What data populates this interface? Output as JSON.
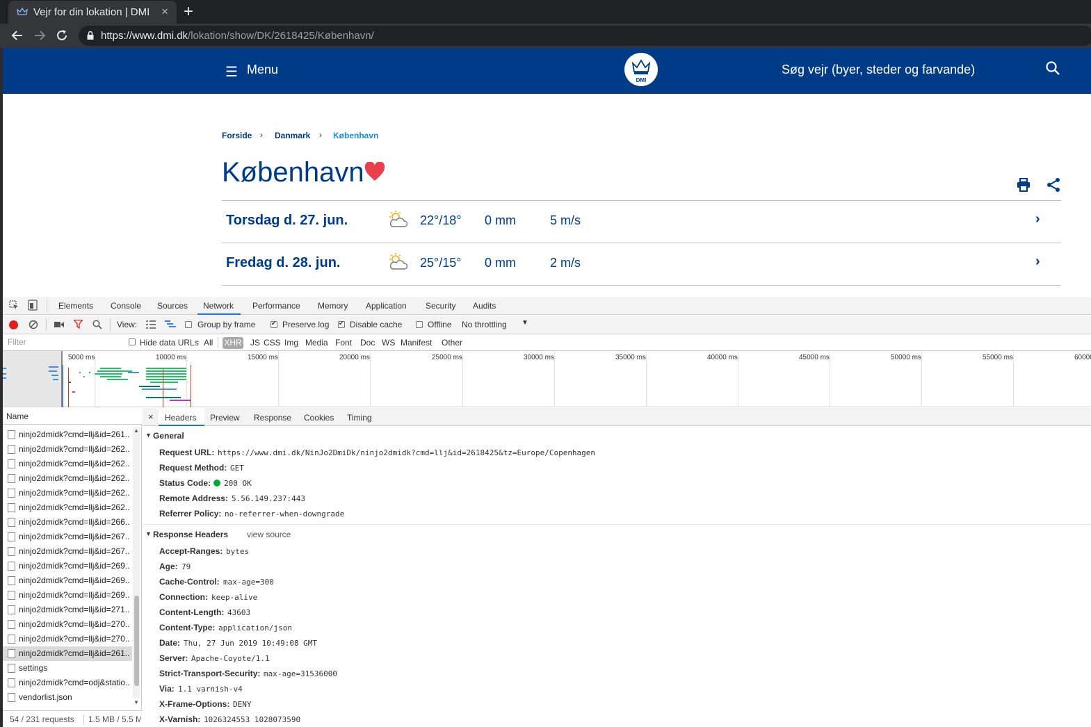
{
  "browser": {
    "tab_title": "Vejr for din lokation | DMI",
    "tab_close": "×",
    "new_tab": "+",
    "url_host": "https://www.dmi.dk",
    "url_path": "/lokation/show/DK/2618425/København/"
  },
  "site": {
    "menu_label": "Menu",
    "logo_text": "DMI",
    "search_placeholder": "Søg vejr (byer, steder og farvande)",
    "breadcrumb": [
      "Forside",
      "Danmark",
      "København"
    ],
    "breadcrumb_sep": "›",
    "city": "København",
    "colors": {
      "header": "#003b87",
      "heart": "#e8414d",
      "breadcrumb_active": "#1a8fd1"
    },
    "forecast": [
      {
        "day": "Torsdag d. 27. jun.",
        "temp": "22°/18°",
        "rain": "0 mm",
        "wind": "5 m/s",
        "icon": "partly-cloudy-icon"
      },
      {
        "day": "Fredag d. 28. jun.",
        "temp": "25°/15°",
        "rain": "0 mm",
        "wind": "2 m/s",
        "icon": "partly-cloudy-icon"
      }
    ]
  },
  "devtools": {
    "tabs": [
      "Elements",
      "Console",
      "Sources",
      "Network",
      "Performance",
      "Memory",
      "Application",
      "Security",
      "Audits"
    ],
    "active_tab": "Network",
    "toolbar": {
      "view_label": "View:",
      "group_by_frame": "Group by frame",
      "preserve_log": "Preserve log",
      "disable_cache": "Disable cache",
      "offline": "Offline",
      "throttling": "No throttling"
    },
    "filter": {
      "placeholder": "Filter",
      "hide_data_urls": "Hide data URLs",
      "types": [
        "All",
        "XHR",
        "JS",
        "CSS",
        "Img",
        "Media",
        "Font",
        "Doc",
        "WS",
        "Manifest",
        "Other"
      ],
      "active_type": "XHR"
    },
    "timeline_ticks": [
      "5000 ms",
      "10000 ms",
      "15000 ms",
      "20000 ms",
      "25000 ms",
      "30000 ms",
      "35000 ms",
      "40000 ms",
      "45000 ms",
      "50000 ms",
      "55000 ms",
      "60000"
    ],
    "requests": {
      "header": "Name",
      "items": [
        "ninjo2dmidk?cmd=llj&id=261...",
        "ninjo2dmidk?cmd=llj&id=262...",
        "ninjo2dmidk?cmd=llj&id=262...",
        "ninjo2dmidk?cmd=llj&id=262...",
        "ninjo2dmidk?cmd=llj&id=262...",
        "ninjo2dmidk?cmd=llj&id=262...",
        "ninjo2dmidk?cmd=llj&id=266...",
        "ninjo2dmidk?cmd=llj&id=267...",
        "ninjo2dmidk?cmd=llj&id=267...",
        "ninjo2dmidk?cmd=llj&id=269...",
        "ninjo2dmidk?cmd=llj&id=269...",
        "ninjo2dmidk?cmd=llj&id=269...",
        "ninjo2dmidk?cmd=llj&id=271...",
        "ninjo2dmidk?cmd=llj&id=270...",
        "ninjo2dmidk?cmd=llj&id=270...",
        "ninjo2dmidk?cmd=llj&id=261...",
        "settings",
        "ninjo2dmidk?cmd=odj&statio...",
        "vendorlist.json"
      ],
      "selected_index": 15,
      "footer_count": "54 / 231 requests",
      "footer_size": "1.5 MB / 5.5 M"
    },
    "detail_tabs": [
      "Headers",
      "Preview",
      "Response",
      "Cookies",
      "Timing"
    ],
    "active_detail_tab": "Headers",
    "general": {
      "title": "General",
      "rows": [
        {
          "k": "Request URL:",
          "v": "https://www.dmi.dk/NinJo2DmiDk/ninjo2dmidk?cmd=llj&id=2618425&tz=Europe/Copenhagen"
        },
        {
          "k": "Request Method:",
          "v": "GET"
        },
        {
          "k": "Status Code:",
          "v": "200 OK"
        },
        {
          "k": "Remote Address:",
          "v": "5.56.149.237:443"
        },
        {
          "k": "Referrer Policy:",
          "v": "no-referrer-when-downgrade"
        }
      ]
    },
    "response_headers": {
      "title": "Response Headers",
      "view_source": "view source",
      "rows": [
        {
          "k": "Accept-Ranges:",
          "v": "bytes"
        },
        {
          "k": "Age:",
          "v": "79"
        },
        {
          "k": "Cache-Control:",
          "v": "max-age=300"
        },
        {
          "k": "Connection:",
          "v": "keep-alive"
        },
        {
          "k": "Content-Length:",
          "v": "43603"
        },
        {
          "k": "Content-Type:",
          "v": "application/json"
        },
        {
          "k": "Date:",
          "v": "Thu, 27 Jun 2019 10:49:08 GMT"
        },
        {
          "k": "Server:",
          "v": "Apache-Coyote/1.1"
        },
        {
          "k": "Strict-Transport-Security:",
          "v": "max-age=31536000"
        },
        {
          "k": "Via:",
          "v": "1.1 varnish-v4"
        },
        {
          "k": "X-Frame-Options:",
          "v": "DENY"
        },
        {
          "k": "X-Varnish:",
          "v": "1026324553 1028073590"
        }
      ]
    }
  }
}
